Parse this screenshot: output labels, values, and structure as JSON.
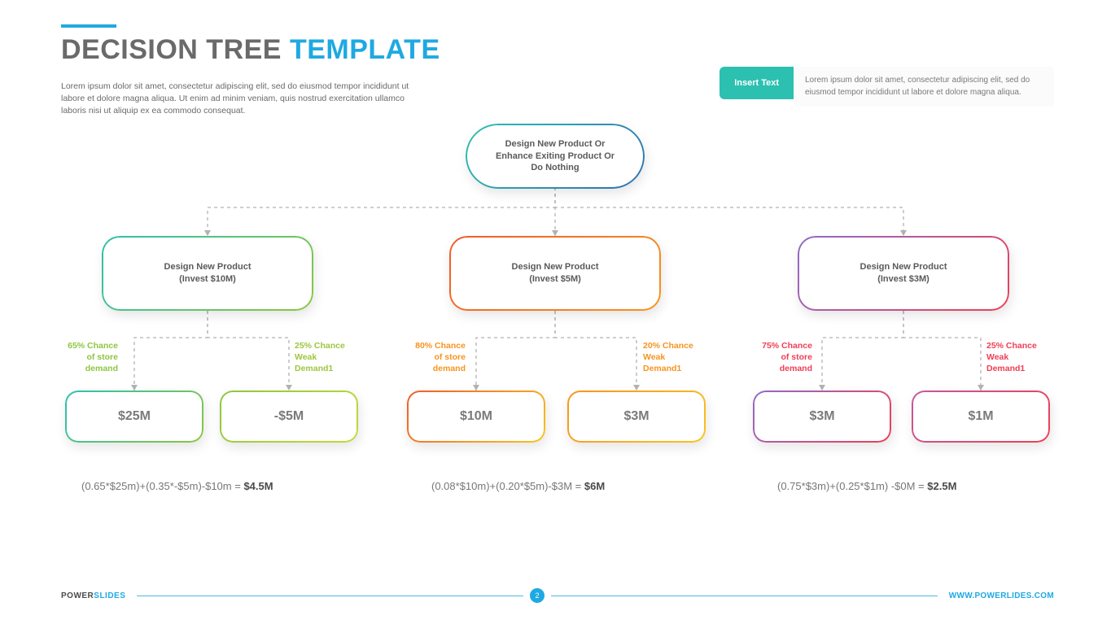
{
  "title_main": "DECISION TREE ",
  "title_accent": "TEMPLATE",
  "subtitle": "Lorem ipsum dolor sit amet, consectetur adipiscing elit, sed do eiusmod tempor incididunt ut labore et dolore magna aliqua. Ut enim ad minim veniam, quis nostrud exercitation ullamco laboris nisi ut aliquip ex ea commodo consequat.",
  "callout_tag": "Insert Text",
  "callout_text": "Lorem ipsum dolor sit amet, consectetur adipiscing elit, sed do eiusmod tempor incididunt ut labore et dolore magna aliqua.",
  "root_l1": "Design New Product Or",
  "root_l2": "Enhance Exiting Product Or",
  "root_l3": "Do Nothing",
  "branches": [
    {
      "mid_l1": "Design New Product",
      "mid_l2": "(Invest $10M)",
      "left_label_l1": "65% Chance",
      "left_label_l2": "of store",
      "left_label_l3": "demand",
      "right_label_l1": "25% Chance",
      "right_label_l2": "Weak",
      "right_label_l3": "Demand1",
      "leaf_left": "$25M",
      "leaf_right": "-$5M",
      "calc_expr": "(0.65*$25m)+(0.35*-$5m)-$10m = ",
      "calc_result": "$4.5M"
    },
    {
      "mid_l1": "Design New Product",
      "mid_l2": "(Invest $5M)",
      "left_label_l1": "80% Chance",
      "left_label_l2": "of store",
      "left_label_l3": "demand",
      "right_label_l1": "20% Chance",
      "right_label_l2": "Weak",
      "right_label_l3": "Demand1",
      "leaf_left": "$10M",
      "leaf_right": "$3M",
      "calc_expr": "(0.08*$10m)+(0.20*$5m)-$3M = ",
      "calc_result": "$6M"
    },
    {
      "mid_l1": "Design New Product",
      "mid_l2": "(Invest $3M)",
      "left_label_l1": "75% Chance",
      "left_label_l2": "of store",
      "left_label_l3": "demand",
      "right_label_l1": "25% Chance",
      "right_label_l2": "Weak",
      "right_label_l3": "Demand1",
      "leaf_left": "$3M",
      "leaf_right": "$1M",
      "calc_expr": "(0.75*$3m)+(0.25*$1m) -$0M = ",
      "calc_result": "$2.5M"
    }
  ],
  "colors": {
    "branch1_mid": "linear-gradient(135deg,#2cc0b0,#8dc63f)",
    "branch1_leafL": "linear-gradient(135deg,#2cc0b0,#8dc63f)",
    "branch1_leafR": "linear-gradient(135deg,#8dc63f,#c5d93a)",
    "branch1_text": "#8dc63f",
    "branch2_mid": "linear-gradient(135deg,#f15a29,#f7941e)",
    "branch2_leafL": "linear-gradient(135deg,#f15a29,#f7c41e)",
    "branch2_leafR": "linear-gradient(135deg,#f7941e,#f7c41e)",
    "branch2_text": "#f7941e",
    "branch3_mid": "linear-gradient(135deg,#8e6cc9,#ef3e55)",
    "branch3_leafL": "linear-gradient(135deg,#8e6cc9,#ef3e55)",
    "branch3_leafR": "linear-gradient(135deg,#c05a9b,#ef3e55)",
    "branch3_text": "#ef3e55"
  },
  "footer_brand_dark": "POWER",
  "footer_brand_accent": "SLIDES",
  "footer_page": "2",
  "footer_url": "WWW.POWERLIDES.COM",
  "chart_data": {
    "type": "decision-tree",
    "root": "Design New Product Or Enhance Exiting Product Or Do Nothing",
    "options": [
      {
        "name": "Design New Product",
        "invest_usd_m": 10,
        "outcomes": [
          {
            "prob": 0.65,
            "label": "Chance of store demand",
            "payoff_usd_m": 25
          },
          {
            "prob": 0.25,
            "label": "Chance Weak Demand1",
            "payoff_usd_m": -5
          }
        ],
        "expected_value_text": "(0.65*$25m)+(0.35*-$5m)-$10m",
        "expected_value_usd_m": 4.5
      },
      {
        "name": "Design New Product",
        "invest_usd_m": 5,
        "outcomes": [
          {
            "prob": 0.8,
            "label": "Chance of store demand",
            "payoff_usd_m": 10
          },
          {
            "prob": 0.2,
            "label": "Chance Weak Demand1",
            "payoff_usd_m": 3
          }
        ],
        "expected_value_text": "(0.08*$10m)+(0.20*$5m)-$3M",
        "expected_value_usd_m": 6
      },
      {
        "name": "Design New Product",
        "invest_usd_m": 3,
        "outcomes": [
          {
            "prob": 0.75,
            "label": "Chance of store demand",
            "payoff_usd_m": 3
          },
          {
            "prob": 0.25,
            "label": "Chance Weak Demand1",
            "payoff_usd_m": 1
          }
        ],
        "expected_value_text": "(0.75*$3m)+(0.25*$1m)-$0M",
        "expected_value_usd_m": 2.5
      }
    ]
  }
}
